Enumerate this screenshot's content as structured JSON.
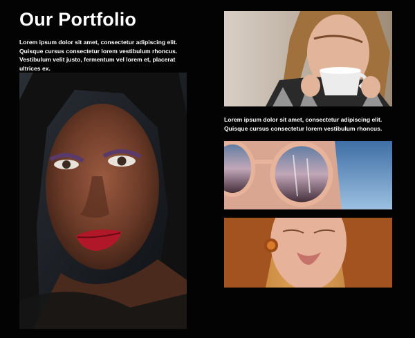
{
  "portfolio": {
    "title": "Our Portfolio",
    "intro_text": "Lorem ipsum dolor sit amet, consectetur adipiscing elit. Quisque cursus consectetur lorem vestibulum rhoncus. Vestibulum velit justo, fermentum vel lorem et, placerat ultrices ex.",
    "caption_text": "Lorem ipsum dolor sit amet, consectetur adipiscing elit. Quisque cursus consectetur lorem vestibulum rhoncus."
  },
  "images": [
    {
      "subject": "woman-portrait-red-lips"
    },
    {
      "subject": "woman-drinking-coffee"
    },
    {
      "subject": "sunglasses-closeup"
    },
    {
      "subject": "redhead-woman-earring"
    }
  ],
  "colors": {
    "background": "#030303",
    "text": "#ffffff"
  }
}
